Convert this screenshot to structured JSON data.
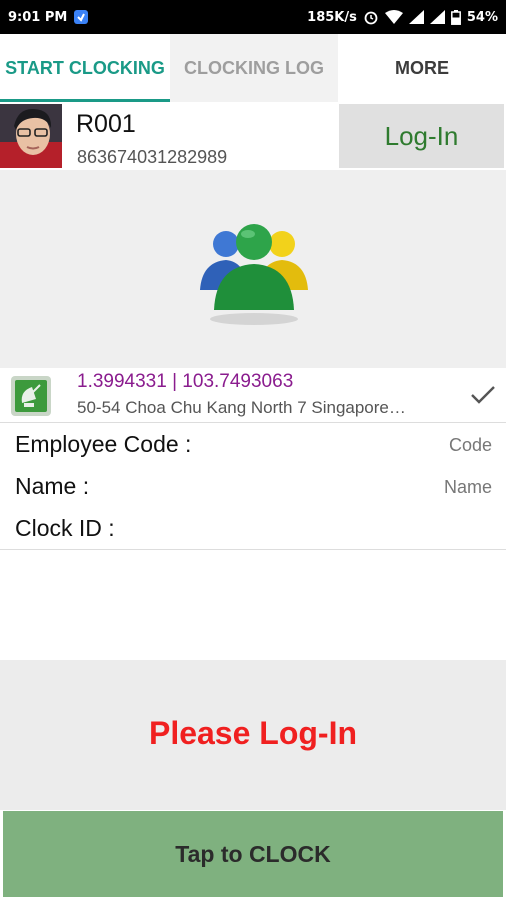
{
  "status_bar": {
    "time": "9:01 PM",
    "speed": "185K/s",
    "battery": "54%",
    "icons": [
      "app-notification-icon",
      "alarm-icon",
      "wifi-icon",
      "signal-icon",
      "signal-icon",
      "battery-icon"
    ]
  },
  "tabs": [
    {
      "label": "START CLOCKING",
      "active": true
    },
    {
      "label": "CLOCKING LOG",
      "active": false
    },
    {
      "label": "MORE",
      "active": false
    }
  ],
  "profile": {
    "id": "R001",
    "device_number": "863674031282989",
    "login_button": "Log-In"
  },
  "location": {
    "coordinates": "1.3994331 | 103.7493063",
    "address": "50-54 Choa Chu Kang North 7 Singapore…"
  },
  "form": {
    "employee_code_label": "Employee Code :",
    "employee_code_placeholder": "Code",
    "name_label": "Name :",
    "name_placeholder": "Name",
    "clock_id_label": "Clock ID :"
  },
  "message": "Please Log-In",
  "clock_button": "Tap to CLOCK",
  "colors": {
    "accent": "#1a9a87",
    "login_text": "#2f7b2f",
    "coords": "#8a1c8e",
    "warning": "#f02020",
    "clock_button_bg": "#7fb17f"
  }
}
